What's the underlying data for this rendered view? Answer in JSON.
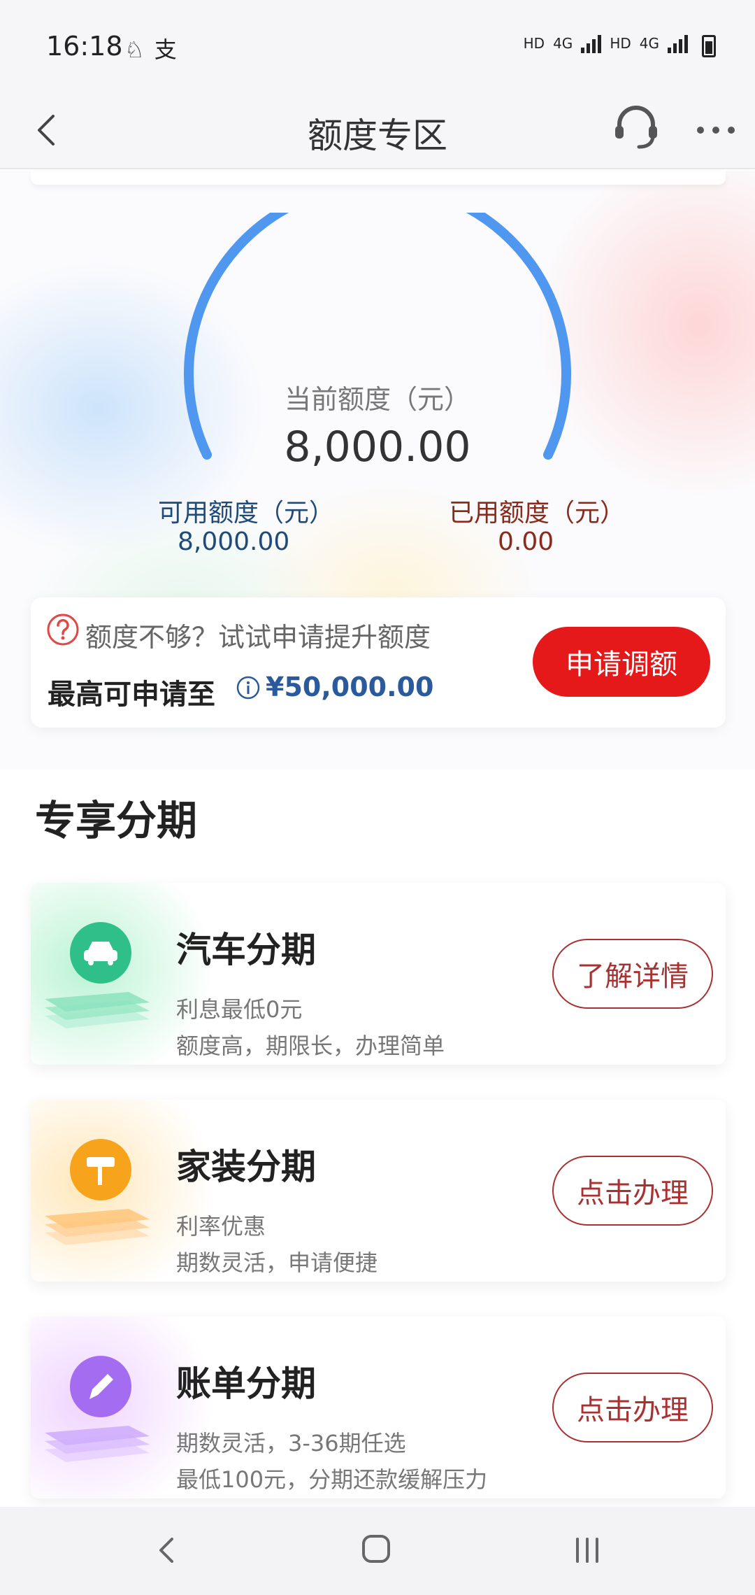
{
  "status_bar": {
    "time": "16:18",
    "notif_icons": [
      "notification-icon",
      "alipay-icon"
    ],
    "network_labels": [
      "HD",
      "4G",
      "HD",
      "4G"
    ]
  },
  "header": {
    "title": "额度专区",
    "icons": [
      "back-icon",
      "customer-service-icon",
      "more-icon"
    ]
  },
  "credit": {
    "current_label": "当前额度（元）",
    "current_value": "8,000.00",
    "available_label": "可用额度（元）",
    "available_value": "8,000.00",
    "used_label": "已用额度（元）",
    "used_value": "0.00",
    "gauge_color": "#4f97ef"
  },
  "promo": {
    "hint": "额度不够？试试申请提升额度",
    "max_label": "最高可申请至",
    "max_value": "¥50,000.00",
    "button_label": "申请调额",
    "button_color": "#e5191a"
  },
  "section": {
    "title": "专享分期",
    "items": [
      {
        "title": "汽车分期",
        "line1": "利息最低0元",
        "line2": "额度高，期限长，办理简单",
        "button": "了解详情",
        "icon": "car-icon",
        "accent": "#2fc08a"
      },
      {
        "title": "家装分期",
        "line1": "利率优惠",
        "line2": "期数灵活，申请便捷",
        "button": "点击办理",
        "icon": "paint-roller-icon",
        "accent": "#f7a41c"
      },
      {
        "title": "账单分期",
        "line1": "期数灵活，3-36期任选",
        "line2": "最低100元，分期还款缓解压力",
        "button": "点击办理",
        "icon": "pencil-icon",
        "accent": "#a46cf0"
      }
    ]
  },
  "nav_bar": {
    "icons": [
      "nav-back-icon",
      "nav-home-icon",
      "nav-recent-icon"
    ]
  }
}
